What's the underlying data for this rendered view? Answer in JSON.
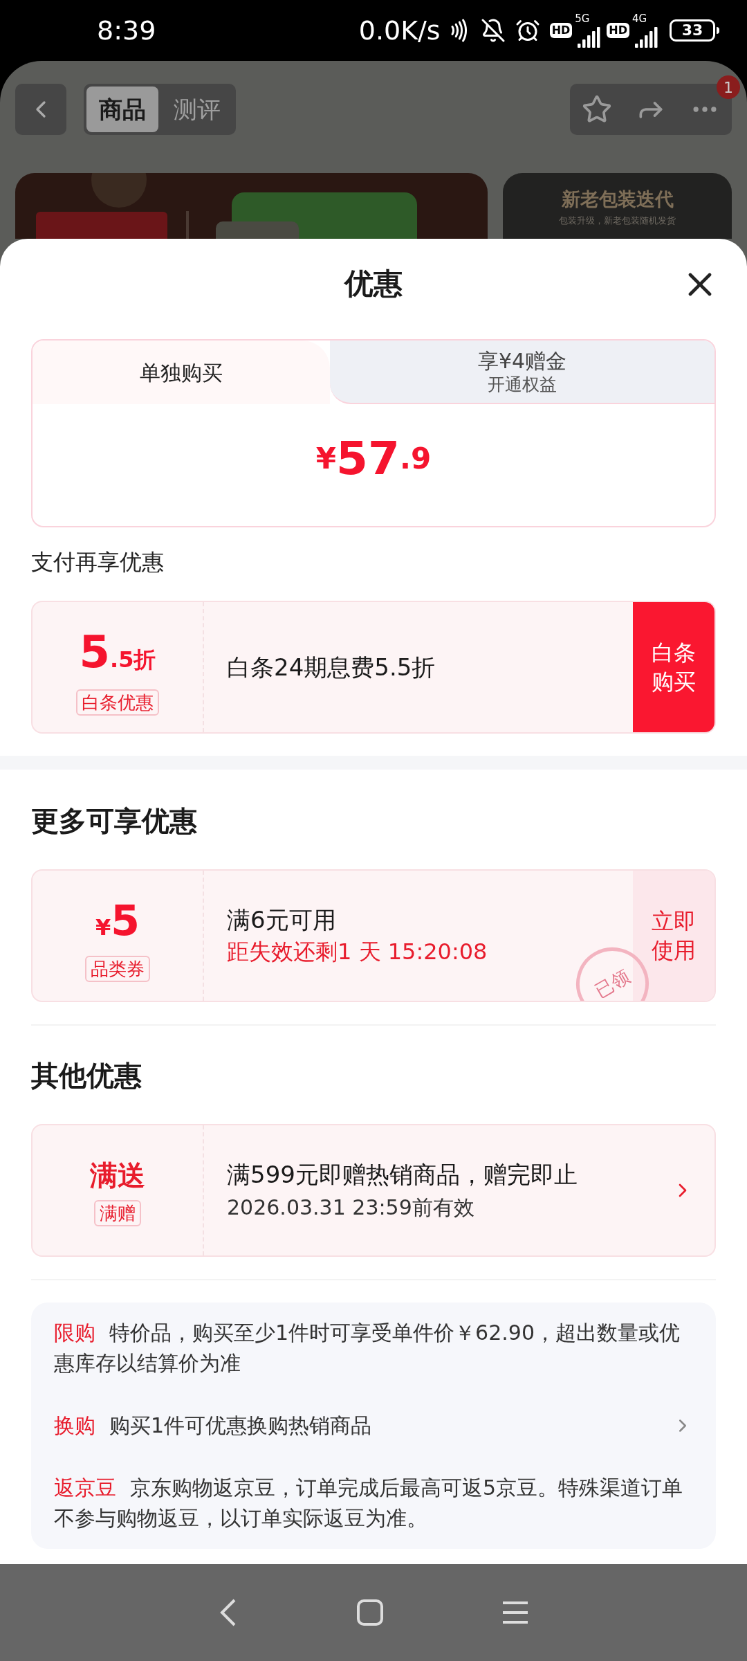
{
  "status_bar": {
    "time": "8:39",
    "network_speed": "0.0K/s",
    "hd_badges": [
      "HD",
      "HD"
    ],
    "network_types": [
      "5G",
      "4G"
    ],
    "battery": "33"
  },
  "background_page": {
    "tabs": [
      {
        "label": "商品",
        "selected": true
      },
      {
        "label": "测评",
        "selected": false
      }
    ],
    "notification_badge": "1",
    "side_banner": {
      "title": "新老包装迭代",
      "subtitle": "包装升级，新老包装随机发货"
    }
  },
  "sheet": {
    "title": "优惠",
    "purchase_tabs": [
      {
        "label": "单独购买",
        "selected": true
      },
      {
        "label": "享¥4赠金",
        "sublabel": "开通权益",
        "selected": false
      }
    ],
    "price": {
      "symbol": "¥",
      "integer": "57",
      "decimal": ".9"
    },
    "payment_section": {
      "heading": "支付再享优惠",
      "offers": [
        {
          "value": "5",
          "value_suffix": ".5折",
          "tag": "白条优惠",
          "description": "白条24期息费5.5折",
          "action": "白条购买"
        }
      ]
    },
    "more_section": {
      "heading": "更多可享优惠",
      "coupons": [
        {
          "currency": "¥",
          "value": "5",
          "tag": "品类券",
          "condition": "满6元可用",
          "countdown": "距失效还剩1 天 15:20:08",
          "action": "立即使用",
          "stamp": "已领"
        }
      ]
    },
    "other_section": {
      "heading": "其他优惠",
      "promos": [
        {
          "title": "满送",
          "tag": "满赠",
          "description": "满599元即赠热销商品，赠完即止",
          "validity": "2026.03.31 23:59前有效"
        }
      ]
    },
    "info": [
      {
        "label": "限购",
        "text": "特价品，购买至少1件时可享受单件价￥62.90，超出数量或优惠库存以结算价为准",
        "has_arrow": false
      },
      {
        "label": "换购",
        "text": "购买1件可优惠换购热销商品",
        "has_arrow": true
      },
      {
        "label": "返京豆",
        "text": "京东购物返京豆，订单完成后最高可返5京豆。特殊渠道订单不参与购物返豆，以订单实际返豆为准。",
        "has_arrow": false
      }
    ]
  }
}
